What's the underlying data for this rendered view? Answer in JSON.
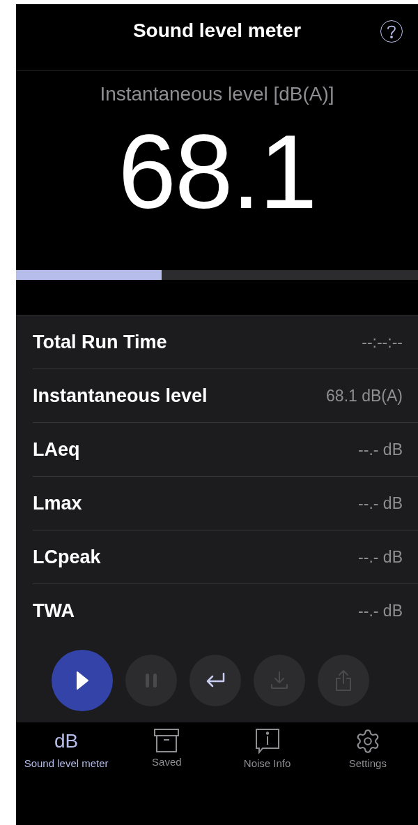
{
  "header": {
    "title": "Sound level meter"
  },
  "display": {
    "label": "Instantaneous level [dB(A)]",
    "value": "68.1",
    "meter": {
      "level": 0.362
    }
  },
  "measurements": [
    {
      "name": "Total Run Time",
      "value": "--:--:--"
    },
    {
      "name": "Instantaneous level",
      "value": "68.1 dB(A)"
    },
    {
      "name": "LAeq",
      "value": "--.- dB"
    },
    {
      "name": "Lmax",
      "value": "--.- dB"
    },
    {
      "name": "LCpeak",
      "value": "--.- dB"
    },
    {
      "name": "TWA",
      "value": "--.- dB"
    }
  ],
  "controls": [
    {
      "kind": "play",
      "disabled": false
    },
    {
      "kind": "pause",
      "disabled": true
    },
    {
      "kind": "return",
      "disabled": false
    },
    {
      "kind": "download",
      "disabled": true
    },
    {
      "kind": "share",
      "disabled": true
    }
  ],
  "tabs": [
    {
      "kind": "text",
      "glyph": "dB",
      "label": "Sound level meter",
      "selected": true
    },
    {
      "kind": "archive",
      "label": "Saved",
      "selected": false
    },
    {
      "kind": "info",
      "label": "Noise Info",
      "selected": false
    },
    {
      "kind": "gear",
      "label": "Settings",
      "selected": false
    }
  ]
}
